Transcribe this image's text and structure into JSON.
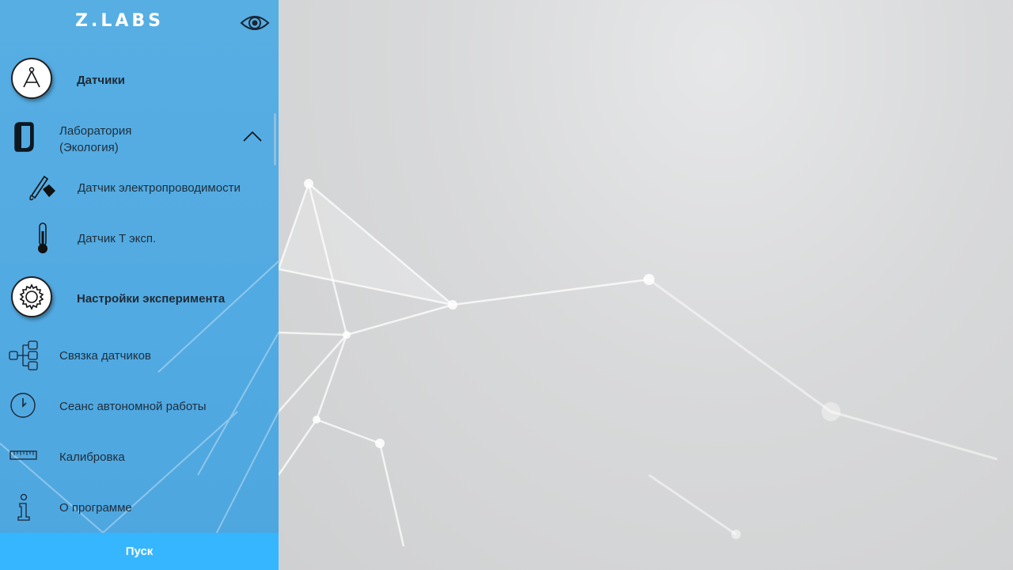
{
  "app": {
    "logo": "Z.LABS"
  },
  "menu": {
    "sensors": "Датчики",
    "lab": {
      "line1": "Лаборатория",
      "line2": "(Экология)"
    },
    "sensor_items": [
      "Датчик электропроводимости",
      "Датчик T эксп."
    ],
    "experiment_settings": "Настройки эксперимента",
    "settings_items": [
      "Связка датчиков",
      "Сеанс автономной работы",
      "Калибровка",
      "О программе"
    ]
  },
  "footer": {
    "start_label": "Пуск"
  },
  "colors": {
    "sidebar": "#52aae2",
    "start_button": "#36b6ff",
    "background": "#d6d8d9"
  }
}
